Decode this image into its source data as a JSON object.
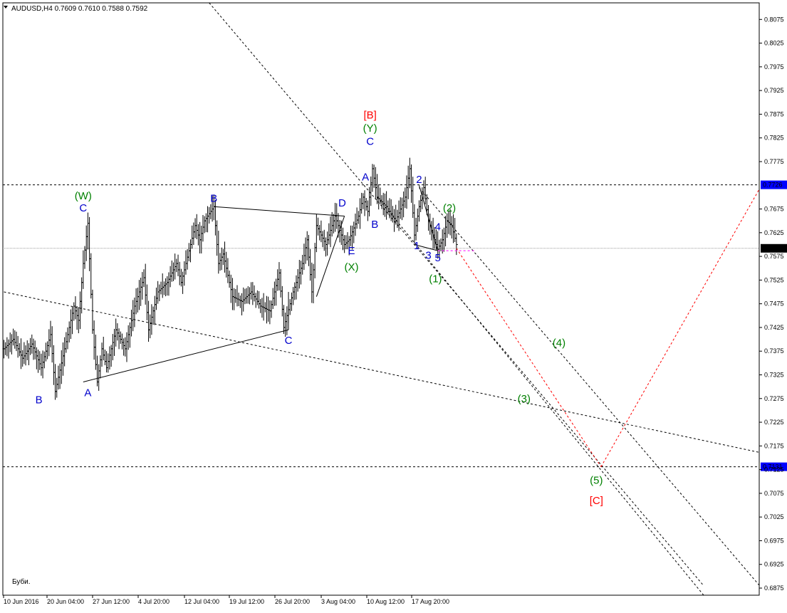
{
  "chart_data": {
    "type": "candlestick",
    "title": "AUDUSD,H4  0.7609 0.7610 0.7588 0.7592",
    "symbol": "AUDUSD",
    "timeframe": "H4",
    "ohlc_readout": {
      "open": 0.7609,
      "high": 0.761,
      "low": 0.7588,
      "close": 0.7592
    },
    "ylim": [
      0.686,
      0.811
    ],
    "y_ticks": [
      0.8075,
      0.8025,
      0.7975,
      0.7925,
      0.7875,
      0.7825,
      0.7775,
      0.7675,
      0.7625,
      0.7575,
      0.7525,
      0.7475,
      0.7425,
      0.7375,
      0.7325,
      0.7275,
      0.7225,
      0.7175,
      0.7125,
      0.7075,
      0.7025,
      0.6975,
      0.6925,
      0.6875
    ],
    "y_tick_labels": [
      "0.8075",
      "0.8025",
      "0.7975",
      "0.7925",
      "0.7875",
      "0.7825",
      "0.7775",
      "0.7675",
      "0.7625",
      "0.7575",
      "0.7525",
      "0.7475",
      "0.7425",
      "0.7375",
      "0.7325",
      "0.7275",
      "0.7225",
      "0.7175",
      "0.7125",
      "0.7075",
      "0.7025",
      "0.6975",
      "0.6925",
      "0.6875"
    ],
    "x_tick_labels": [
      "10 Jun 2016",
      "20 Jun 04:00",
      "27 Jun 12:00",
      "4 Jul 20:00",
      "12 Jul 04:00",
      "19 Jul 12:00",
      "26 Jul 20:00",
      "3 Aug 04:00",
      "10 Aug 12:00",
      "17 Aug 20:00"
    ],
    "price_levels": [
      {
        "name": "resistance-level",
        "value": 0.7726,
        "label": "0.7726",
        "color": "#0000ff"
      },
      {
        "name": "current-price",
        "value": 0.7592,
        "label": "0.7592",
        "color": "#000000"
      },
      {
        "name": "target-level",
        "value": 0.7131,
        "label": "0.7131",
        "color": "#0000ff"
      }
    ],
    "price_path": [
      {
        "x": 0,
        "y": 0.738
      },
      {
        "x": 2,
        "y": 0.74
      },
      {
        "x": 4,
        "y": 0.736
      },
      {
        "x": 6,
        "y": 0.739
      },
      {
        "x": 8,
        "y": 0.734
      },
      {
        "x": 10,
        "y": 0.741
      },
      {
        "x": 11,
        "y": 0.729
      },
      {
        "x": 13,
        "y": 0.738
      },
      {
        "x": 15,
        "y": 0.747
      },
      {
        "x": 16,
        "y": 0.744
      },
      {
        "x": 17,
        "y": 0.756
      },
      {
        "x": 18,
        "y": 0.7645
      },
      {
        "x": 19,
        "y": 0.742
      },
      {
        "x": 20,
        "y": 0.731
      },
      {
        "x": 21,
        "y": 0.738
      },
      {
        "x": 22,
        "y": 0.734
      },
      {
        "x": 24,
        "y": 0.742
      },
      {
        "x": 26,
        "y": 0.738
      },
      {
        "x": 28,
        "y": 0.747
      },
      {
        "x": 30,
        "y": 0.753
      },
      {
        "x": 31,
        "y": 0.742
      },
      {
        "x": 33,
        "y": 0.75
      },
      {
        "x": 35,
        "y": 0.752
      },
      {
        "x": 37,
        "y": 0.756
      },
      {
        "x": 38,
        "y": 0.752
      },
      {
        "x": 40,
        "y": 0.76
      },
      {
        "x": 41,
        "y": 0.764
      },
      {
        "x": 42,
        "y": 0.761
      },
      {
        "x": 43,
        "y": 0.765
      },
      {
        "x": 45,
        "y": 0.768
      },
      {
        "x": 46,
        "y": 0.756
      },
      {
        "x": 47,
        "y": 0.758
      },
      {
        "x": 49,
        "y": 0.749
      },
      {
        "x": 51,
        "y": 0.748
      },
      {
        "x": 53,
        "y": 0.75
      },
      {
        "x": 55,
        "y": 0.747
      },
      {
        "x": 57,
        "y": 0.746
      },
      {
        "x": 59,
        "y": 0.754
      },
      {
        "x": 60,
        "y": 0.7425
      },
      {
        "x": 62,
        "y": 0.75
      },
      {
        "x": 64,
        "y": 0.756
      },
      {
        "x": 65,
        "y": 0.761
      },
      {
        "x": 66,
        "y": 0.75
      },
      {
        "x": 67,
        "y": 0.764
      },
      {
        "x": 69,
        "y": 0.76
      },
      {
        "x": 71,
        "y": 0.766
      },
      {
        "x": 73,
        "y": 0.76
      },
      {
        "x": 74,
        "y": 0.761
      },
      {
        "x": 76,
        "y": 0.766
      },
      {
        "x": 77,
        "y": 0.77
      },
      {
        "x": 78,
        "y": 0.767
      },
      {
        "x": 79,
        "y": 0.776
      },
      {
        "x": 80,
        "y": 0.77
      },
      {
        "x": 82,
        "y": 0.768
      },
      {
        "x": 84,
        "y": 0.765
      },
      {
        "x": 86,
        "y": 0.77
      },
      {
        "x": 87,
        "y": 0.776
      },
      {
        "x": 88,
        "y": 0.762
      },
      {
        "x": 89,
        "y": 0.768
      },
      {
        "x": 90,
        "y": 0.772
      },
      {
        "x": 91,
        "y": 0.765
      },
      {
        "x": 92,
        "y": 0.762
      },
      {
        "x": 93,
        "y": 0.759
      },
      {
        "x": 94,
        "y": 0.761
      },
      {
        "x": 95,
        "y": 0.765
      },
      {
        "x": 96,
        "y": 0.764
      },
      {
        "x": 97,
        "y": 0.76
      }
    ],
    "trend_lines": [
      {
        "name": "channel-upper-line",
        "style": "dotted",
        "color": "#000000",
        "from": {
          "x": 44,
          "y": 0.811
        },
        "to": {
          "x": 150,
          "y": 0.688
        }
      },
      {
        "x_note": "",
        "name": "channel-lower-line",
        "style": "dotted",
        "color": "#000000",
        "from": {
          "x": 80,
          "y": 0.77
        },
        "to": {
          "x": 150,
          "y": 0.686
        }
      },
      {
        "name": "channel-parallel-line",
        "style": "dotted",
        "color": "#000000",
        "from": {
          "x": 89,
          "y": 0.772
        },
        "to": {
          "x": 162,
          "y": 0.688
        }
      },
      {
        "name": "long-support-line",
        "style": "dotted",
        "color": "#000000",
        "from": {
          "x": 0,
          "y": 0.75
        },
        "to": {
          "x": 165,
          "y": 0.7155
        }
      },
      {
        "name": "projection-down-line",
        "style": "dotted",
        "color": "#ff0000",
        "from": {
          "x": 97,
          "y": 0.7592
        },
        "to": {
          "x": 128,
          "y": 0.7131
        }
      },
      {
        "name": "projection-up-line",
        "style": "dotted",
        "color": "#ff0000",
        "from": {
          "x": 128,
          "y": 0.7131
        },
        "to": {
          "x": 165,
          "y": 0.777
        }
      },
      {
        "name": "triangle-upper-side",
        "style": "solid",
        "color": "#000000",
        "from": {
          "x": 45,
          "y": 0.768
        },
        "to": {
          "x": 73,
          "y": 0.766
        }
      },
      {
        "name": "triangle-lower-side",
        "style": "solid",
        "color": "#000000",
        "from": {
          "x": 17,
          "y": 0.731
        },
        "to": {
          "x": 61,
          "y": 0.742
        }
      },
      {
        "name": "triangle-right-side",
        "style": "solid",
        "color": "#000000",
        "from": {
          "x": 61,
          "y": 0.742
        },
        "to": {
          "x": 61,
          "y": 0.75
        }
      },
      {
        "name": "e-wave-side",
        "style": "solid",
        "color": "#000000",
        "from": {
          "x": 67,
          "y": 0.749
        },
        "to": {
          "x": 73,
          "y": 0.766
        }
      },
      {
        "name": "wedge-lower-side",
        "style": "solid",
        "color": "#000000",
        "from": {
          "x": 88,
          "y": 0.76
        },
        "to": {
          "x": 93,
          "y": 0.7587
        }
      },
      {
        "name": "wedge-upper-side",
        "style": "solid",
        "color": "#000000",
        "from": {
          "x": 89,
          "y": 0.7725
        },
        "to": {
          "x": 93,
          "y": 0.7587
        }
      },
      {
        "name": "low-marker-line",
        "style": "dotted",
        "color": "#ff00ff",
        "from": {
          "x": 93,
          "y": 0.7587
        },
        "to": {
          "x": 101,
          "y": 0.7587
        }
      }
    ],
    "annotations": [
      {
        "text": "(W)",
        "color": "#008000",
        "x": 17,
        "y": 0.7695
      },
      {
        "text": "C",
        "color": "#0000cc",
        "x": 17,
        "y": 0.767
      },
      {
        "text": "B",
        "color": "#0000cc",
        "x": 7.5,
        "y": 0.7265
      },
      {
        "text": "A",
        "color": "#0000cc",
        "x": 18,
        "y": 0.728
      },
      {
        "text": "B",
        "color": "#0000cc",
        "x": 45,
        "y": 0.769
      },
      {
        "text": "C",
        "color": "#0000cc",
        "x": 61,
        "y": 0.739
      },
      {
        "text": "D",
        "color": "#0000cc",
        "x": 72.5,
        "y": 0.768
      },
      {
        "text": "E",
        "color": "#0000cc",
        "x": 74.5,
        "y": 0.758
      },
      {
        "text": "(X)",
        "color": "#008000",
        "x": 74.5,
        "y": 0.7545
      },
      {
        "text": "A",
        "color": "#0000cc",
        "x": 77.5,
        "y": 0.7735
      },
      {
        "text": "B",
        "color": "#0000cc",
        "x": 79.5,
        "y": 0.7635
      },
      {
        "text": "C",
        "color": "#0000cc",
        "x": 78.5,
        "y": 0.781
      },
      {
        "text": "(Y)",
        "color": "#008000",
        "x": 78.5,
        "y": 0.7838
      },
      {
        "text": "[B]",
        "color": "#ff0000",
        "x": 78.5,
        "y": 0.7866
      },
      {
        "text": "2",
        "color": "#0000cc",
        "x": 89,
        "y": 0.773
      },
      {
        "text": "(2)",
        "color": "#008000",
        "x": 95.5,
        "y": 0.767
      },
      {
        "text": "4",
        "color": "#0000cc",
        "x": 93,
        "y": 0.763
      },
      {
        "text": "1",
        "color": "#0000cc",
        "x": 88.5,
        "y": 0.759
      },
      {
        "text": "3",
        "color": "#0000cc",
        "x": 91,
        "y": 0.757
      },
      {
        "text": "5",
        "color": "#0000cc",
        "x": 93,
        "y": 0.7565
      },
      {
        "text": "(1)",
        "color": "#008000",
        "x": 92.5,
        "y": 0.752
      },
      {
        "text": "(4)",
        "color": "#008000",
        "x": 119,
        "y": 0.7385
      },
      {
        "text": "(3)",
        "color": "#008000",
        "x": 111.5,
        "y": 0.7267
      },
      {
        "text": "(5)",
        "color": "#008000",
        "x": 127,
        "y": 0.7095
      },
      {
        "text": "[C]",
        "color": "#ff0000",
        "x": 127,
        "y": 0.7052
      }
    ],
    "watermark": "Буби.",
    "colors": {
      "bars": "#000000",
      "background": "#ffffff",
      "wave_blue": "#0000cc",
      "wave_green": "#008000",
      "wave_red": "#ff0000"
    }
  }
}
